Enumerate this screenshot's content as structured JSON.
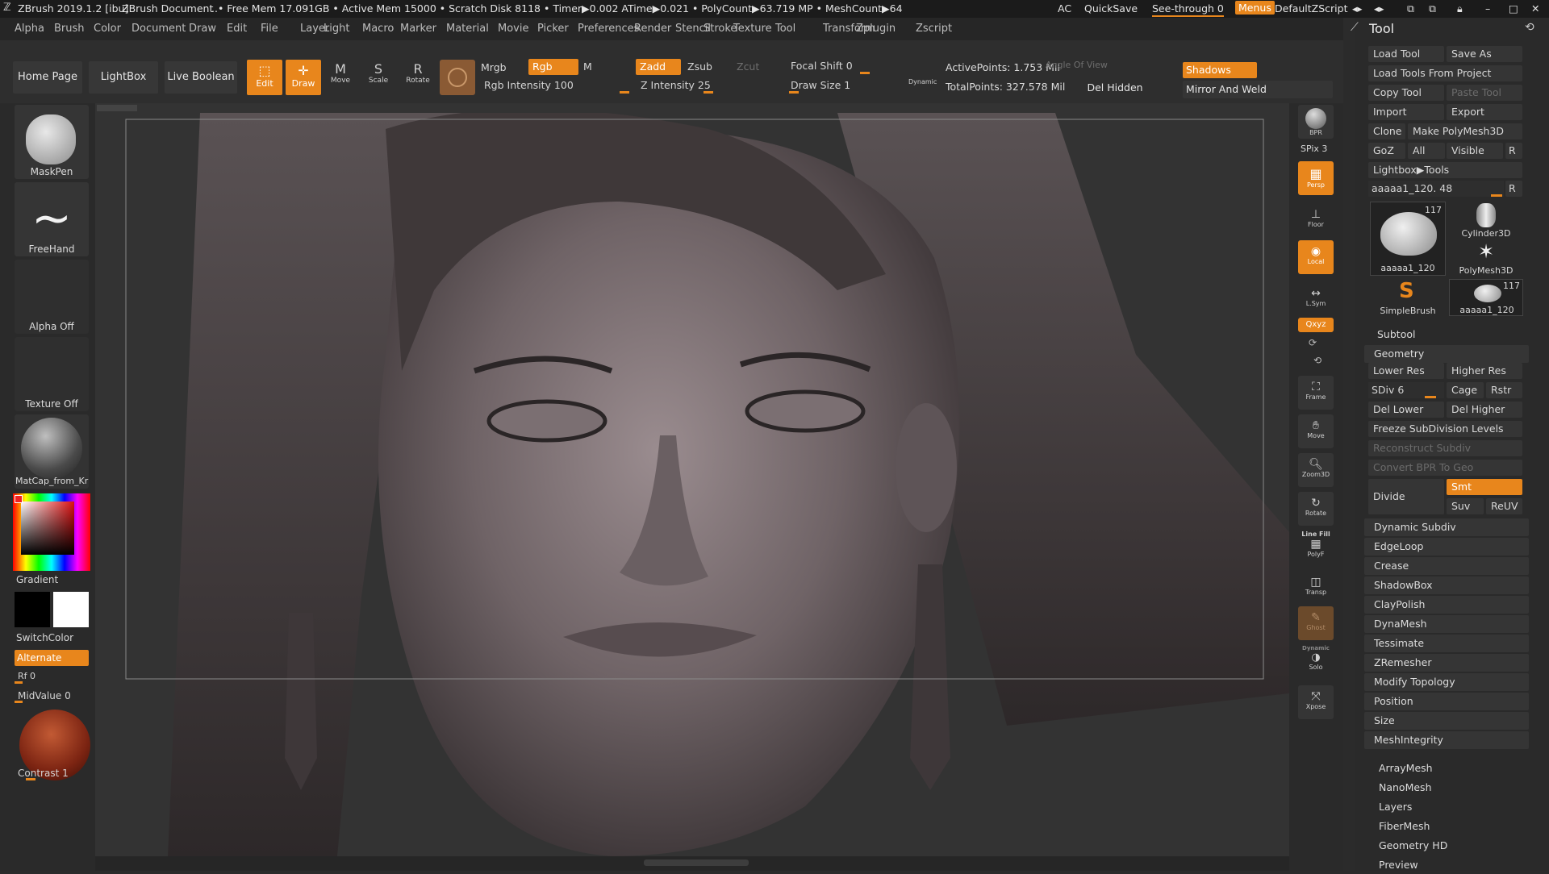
{
  "titlebar": {
    "app": "ZBrush 2019.1.2 [ibu]",
    "document": "ZBrush Document",
    "stats": "..• Free Mem 17.091GB • Active Mem 15000 • Scratch Disk 8118 • Timer▶0.002 ATime▶0.021 • PolyCount▶63.719 MP • MeshCount▶64",
    "ac": "AC",
    "quicksave": "QuickSave",
    "see_through": "See-through  0",
    "menus": "Menus",
    "script": "DefaultZScript"
  },
  "menubar": {
    "items": [
      "Alpha",
      "Brush",
      "Color",
      "Document",
      "Draw",
      "Edit",
      "File",
      "Layer",
      "Light",
      "Macro",
      "Marker",
      "Material",
      "Movie",
      "Picker",
      "Preferences",
      "Render",
      "Stencil",
      "Stroke",
      "Texture",
      "Tool",
      "Transform",
      "Zplugin",
      "Zscript"
    ]
  },
  "toolbar": {
    "home_page": "Home Page",
    "lightbox": "LightBox",
    "live_boolean": "Live Boolean",
    "edit": "Edit",
    "draw": "Draw",
    "move": "Move",
    "scale": "Scale",
    "rotate": "Rotate",
    "mrgb": "Mrgb",
    "rgb": "Rgb",
    "m": "M",
    "zadd": "Zadd",
    "zsub": "Zsub",
    "zcut": "Zcut",
    "rgb_intensity": "Rgb Intensity 100",
    "z_intensity": "Z Intensity 25",
    "focal_shift": "Focal Shift 0",
    "draw_size": "Draw Size 1",
    "dynamic": "Dynamic",
    "active_points": "ActivePoints: 1.753 Mil",
    "total_points": "TotalPoints: 327.578 Mil",
    "angle_of_view": "Angle Of View",
    "del_hidden": "Del Hidden",
    "shadows": "Shadows",
    "mirror_and_weld": "Mirror And Weld"
  },
  "left_panel": {
    "maskpen": "MaskPen",
    "freehand": "FreeHand",
    "alpha_off": "Alpha Off",
    "texture_off": "Texture Off",
    "material": "MatCap_from_Kr",
    "gradient": "Gradient",
    "switch_color": "SwitchColor",
    "alternate": "Alternate",
    "rf": "Rf 0",
    "midvalue": "MidValue 0",
    "contrast": "Contrast 1"
  },
  "right_shelf": {
    "bpr": "BPR",
    "spix": "SPix 3",
    "persp": "Persp",
    "floor": "Floor",
    "local": "Local",
    "lsym": "L.Sym",
    "xyz": "Qxyz",
    "frame": "Frame",
    "move": "Move",
    "zoom3d": "Zoom3D",
    "rotate": "Rotate",
    "line_fill": "Line Fill",
    "polyf": "PolyF",
    "transp": "Transp",
    "ghost": "Ghost",
    "dynamic": "Dynamic",
    "solo": "Solo",
    "xpose": "Xpose"
  },
  "tool_panel": {
    "title": "Tool",
    "load_tool": "Load Tool",
    "save_as": "Save As",
    "load_from_project": "Load Tools From Project",
    "copy_tool": "Copy Tool",
    "paste_tool": "Paste Tool",
    "import": "Import",
    "export": "Export",
    "clone": "Clone",
    "make_polymesh": "Make PolyMesh3D",
    "goz": "GoZ",
    "all": "All",
    "visible": "Visible",
    "r": "R",
    "lightbox_tools": "Lightbox▶Tools",
    "current_tool": "aaaaa1_120. 48",
    "thumbs": [
      {
        "label": "aaaaa1_120",
        "count": "117"
      },
      {
        "label": "Cylinder3D",
        "count": ""
      },
      {
        "label": "PolyMesh3D",
        "count": ""
      },
      {
        "label": "SimpleBrush",
        "count": ""
      },
      {
        "label": "aaaaa1_120",
        "count": "117"
      }
    ],
    "subtool": "Subtool",
    "geometry": "Geometry",
    "lower_res": "Lower Res",
    "higher_res": "Higher Res",
    "sdiv": "SDiv 6",
    "cage": "Cage",
    "rstr": "Rstr",
    "del_lower": "Del Lower",
    "del_higher": "Del Higher",
    "freeze_subdiv": "Freeze SubDivision Levels",
    "reconstruct_subdiv": "Reconstruct Subdiv",
    "convert_bpr": "Convert BPR To Geo",
    "divide": "Divide",
    "smt": "Smt",
    "suv": "Suv",
    "reuv": "ReUV",
    "geometry_items": [
      "Dynamic Subdiv",
      "EdgeLoop",
      "Crease",
      "ShadowBox",
      "ClayPolish",
      "DynaMesh",
      "Tessimate",
      "ZRemesher",
      "Modify Topology",
      "Position",
      "Size",
      "MeshIntegrity"
    ],
    "more_items": [
      "ArrayMesh",
      "NanoMesh",
      "Layers",
      "FiberMesh",
      "Geometry HD",
      "Preview"
    ]
  },
  "colors": {
    "accent": "#e8861c",
    "bg": "#2b2b2b",
    "panel": "#353535"
  }
}
